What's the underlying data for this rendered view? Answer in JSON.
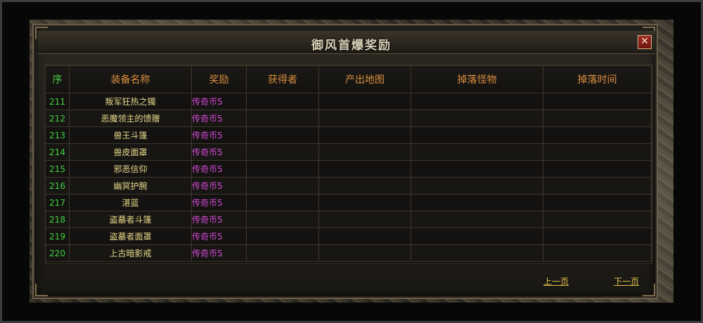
{
  "window": {
    "title": "御风首爆奖励",
    "close_symbol": "✕"
  },
  "table": {
    "headers": [
      "序",
      "装备名称",
      "奖励",
      "获得者",
      "产出地图",
      "掉落怪物",
      "掉落时间"
    ],
    "rows": [
      {
        "index": "211",
        "name": "叛军狂热之镯",
        "reward": "传奇币5",
        "winner": "",
        "map": "",
        "monster": "",
        "time": ""
      },
      {
        "index": "212",
        "name": "恶魔领主的馈赠",
        "reward": "传奇币5",
        "winner": "",
        "map": "",
        "monster": "",
        "time": ""
      },
      {
        "index": "213",
        "name": "兽王斗篷",
        "reward": "传奇币5",
        "winner": "",
        "map": "",
        "monster": "",
        "time": ""
      },
      {
        "index": "214",
        "name": "兽皮面罩",
        "reward": "传奇币5",
        "winner": "",
        "map": "",
        "monster": "",
        "time": ""
      },
      {
        "index": "215",
        "name": "邪恶信仰",
        "reward": "传奇币5",
        "winner": "",
        "map": "",
        "monster": "",
        "time": ""
      },
      {
        "index": "216",
        "name": "幽冥护腕",
        "reward": "传奇币5",
        "winner": "",
        "map": "",
        "monster": "",
        "time": ""
      },
      {
        "index": "217",
        "name": "湛蓝",
        "reward": "传奇币5",
        "winner": "",
        "map": "",
        "monster": "",
        "time": ""
      },
      {
        "index": "218",
        "name": "盗墓者斗篷",
        "reward": "传奇币5",
        "winner": "",
        "map": "",
        "monster": "",
        "time": ""
      },
      {
        "index": "219",
        "name": "盗墓者面罩",
        "reward": "传奇币5",
        "winner": "",
        "map": "",
        "monster": "",
        "time": ""
      },
      {
        "index": "220",
        "name": "上古暗影戒",
        "reward": "传奇币5",
        "winner": "",
        "map": "",
        "monster": "",
        "time": ""
      }
    ]
  },
  "pagination": {
    "prev_label": "上一页",
    "next_label": "下一页"
  },
  "colors": {
    "header_text": "#d98e3f",
    "index_text": "#3fd33f",
    "name_text": "#e6d98a",
    "reward_text": "#d54ad8",
    "link_text": "#e2c24a",
    "close_button": "#8a1f18"
  }
}
